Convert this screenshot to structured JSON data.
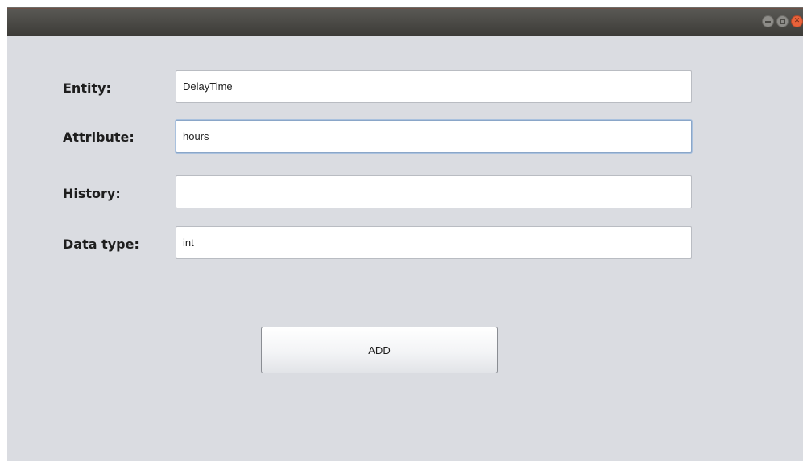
{
  "window": {
    "controls": {
      "minimize_icon": "minimize-icon",
      "maximize_icon": "maximize-icon",
      "close_icon": "close-icon",
      "close_color": "#e8623a"
    }
  },
  "form": {
    "entity": {
      "label": "Entity:",
      "value": "DelayTime"
    },
    "attribute": {
      "label": "Attribute:",
      "value": "hours"
    },
    "history": {
      "label": "History:",
      "value": ""
    },
    "data_type": {
      "label": "Data type:",
      "value": "int"
    }
  },
  "actions": {
    "add_label": "ADD"
  }
}
